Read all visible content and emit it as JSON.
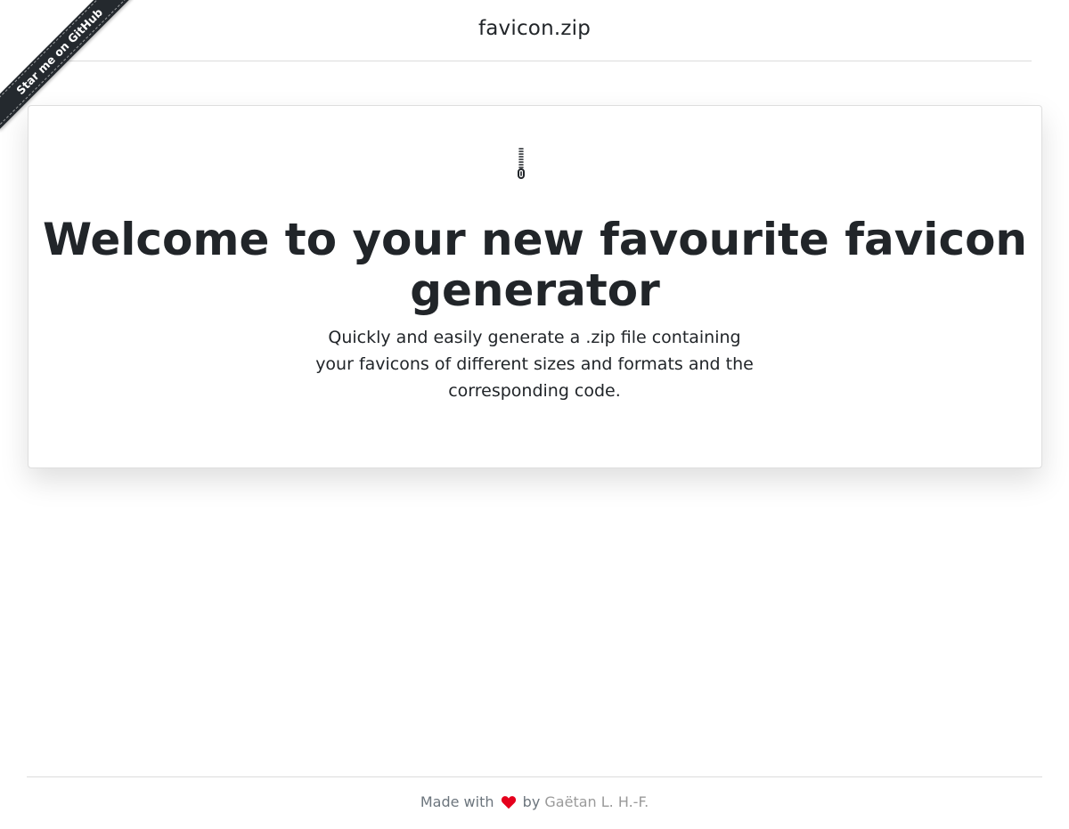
{
  "ribbon": {
    "label": "Star me on GitHub"
  },
  "header": {
    "brand": "favicon.zip"
  },
  "hero": {
    "icon": "zipper-icon",
    "headline": "Welcome to your new favourite favicon generator",
    "tagline": "Quickly and easily generate a .zip file containing your favicons of different sizes and formats and the corresponding code."
  },
  "footer": {
    "made_with": "Made with",
    "heart_icon": "heart-icon",
    "heart_color": "#e5001c",
    "by": "by",
    "author": "Gaëtan L. H.-F."
  }
}
